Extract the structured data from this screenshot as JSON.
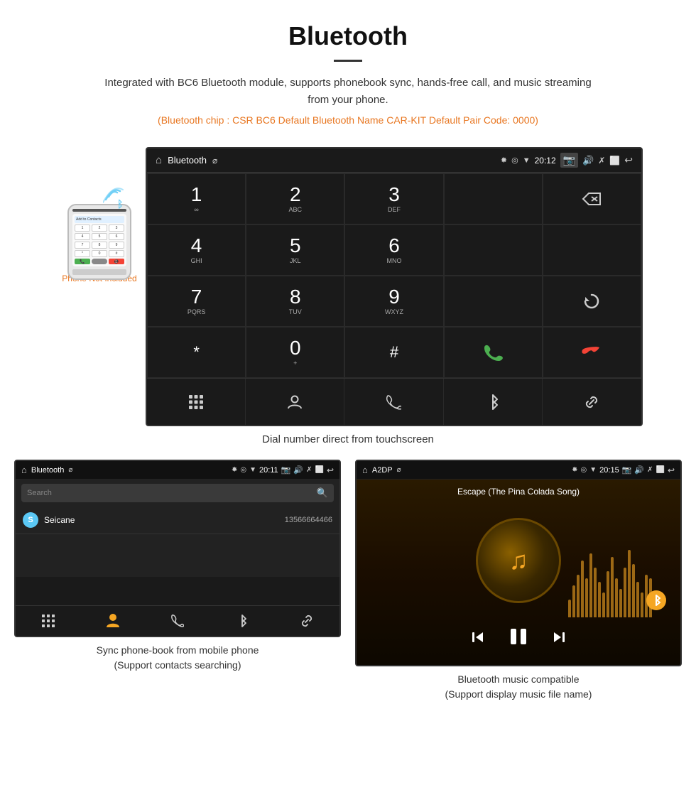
{
  "page": {
    "title": "Bluetooth",
    "divider": true,
    "description": "Integrated with BC6 Bluetooth module, supports phonebook sync, hands-free call, and music streaming from your phone.",
    "specs": "(Bluetooth chip : CSR BC6    Default Bluetooth Name CAR-KIT    Default Pair Code: 0000)"
  },
  "dial_screen": {
    "status_bar": {
      "title": "Bluetooth",
      "usb_icon": "⌀",
      "time": "20:12",
      "icons": [
        "✸",
        "◎",
        "▼",
        "📷",
        "🔊",
        "✗",
        "⬜",
        "↩"
      ]
    },
    "keypad": [
      {
        "num": "1",
        "sub": "∞",
        "col_span": 1
      },
      {
        "num": "2",
        "sub": "ABC",
        "col_span": 1
      },
      {
        "num": "3",
        "sub": "DEF",
        "col_span": 1
      },
      {
        "num": "",
        "sub": "",
        "col_span": 1,
        "type": "empty"
      },
      {
        "num": "⌫",
        "sub": "",
        "col_span": 1,
        "type": "backspace"
      },
      {
        "num": "4",
        "sub": "GHI",
        "col_span": 1
      },
      {
        "num": "5",
        "sub": "JKL",
        "col_span": 1
      },
      {
        "num": "6",
        "sub": "MNO",
        "col_span": 1
      },
      {
        "num": "",
        "sub": "",
        "col_span": 1,
        "type": "empty"
      },
      {
        "num": "",
        "sub": "",
        "col_span": 1,
        "type": "empty"
      },
      {
        "num": "7",
        "sub": "PQRS",
        "col_span": 1
      },
      {
        "num": "8",
        "sub": "TUV",
        "col_span": 1
      },
      {
        "num": "9",
        "sub": "WXYZ",
        "col_span": 1
      },
      {
        "num": "",
        "sub": "",
        "col_span": 1,
        "type": "empty"
      },
      {
        "num": "↺",
        "sub": "",
        "col_span": 1,
        "type": "refresh"
      },
      {
        "num": "*",
        "sub": "",
        "col_span": 1
      },
      {
        "num": "0",
        "sub": "+",
        "col_span": 1
      },
      {
        "num": "#",
        "sub": "",
        "col_span": 1
      },
      {
        "num": "📞",
        "sub": "",
        "col_span": 1,
        "type": "call-green"
      },
      {
        "num": "📵",
        "sub": "",
        "col_span": 1,
        "type": "call-red"
      }
    ],
    "bottom_nav": [
      "⊞",
      "👤",
      "📞",
      "✦",
      "🔗"
    ]
  },
  "dial_caption": "Dial number direct from touchscreen",
  "phonebook_screen": {
    "status_bar": {
      "title": "Bluetooth",
      "usb_icon": "⌀",
      "time": "20:11"
    },
    "search_placeholder": "Search",
    "contact": {
      "letter": "S",
      "name": "Seicane",
      "number": "13566664466"
    },
    "bottom_nav": [
      "⊞",
      "👤",
      "📞",
      "✦",
      "🔗"
    ]
  },
  "phonebook_caption": "Sync phone-book from mobile phone\n(Support contacts searching)",
  "music_screen": {
    "status_bar": {
      "title": "A2DP",
      "usb_icon": "⌀",
      "time": "20:15"
    },
    "song_title": "Escape (The Pina Colada Song)",
    "controls": [
      "⏮",
      "⏯",
      "⏭"
    ],
    "eq_heights": [
      20,
      35,
      50,
      60,
      45,
      70,
      55,
      40,
      30,
      50,
      65,
      45,
      35,
      55,
      70,
      60,
      40,
      30,
      50,
      45
    ]
  },
  "music_caption": "Bluetooth music compatible\n(Support display music file name)",
  "phone_not_included": "Phone Not Included",
  "colors": {
    "orange": "#e87722",
    "blue": "#5bc8f5",
    "dark_bg": "#1a1a1a",
    "green_call": "#4caf50",
    "red_call": "#f44336"
  }
}
